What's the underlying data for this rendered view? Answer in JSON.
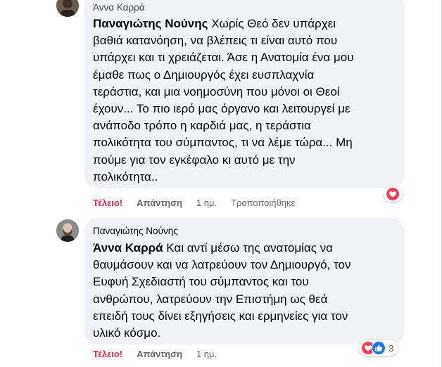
{
  "colors": {
    "bubble_bg": "#f0f2f5",
    "reaction_red": "#f02849",
    "love_red": "#f33e58",
    "like_blue": "#1877f2",
    "meta_gray": "#65676b"
  },
  "comments": [
    {
      "author": "Άννα Καρρά",
      "mention": "Παναγιώτης Νούνης",
      "lines": [
        "Χωρίς Θεό δεν υπάρχει",
        "βαθιά κατανόηση, να βλέπεις τι είναι αυτό που",
        "υπάρχει και τι χρειάζεται. Άσε η Ανατομία ένα μου",
        "έμαθε πως ο Δημιουργός έχει ευσπλαχνία",
        "τεράστια, και μια νοημοσύνη που μόνοι οι Θεοί",
        "έχουν... Το πιο ιερό μας όργανο και λειτουργεί με",
        "ανάποδο τρόπο η καρδιά μας, η τεράστια",
        "πολικότητα του σύμπαντος, τι να λέμε τώρα... Μη",
        "πούμε για τον εγκέφαλο κι αυτό με την",
        "πολικότητα.."
      ],
      "actions": {
        "reaction": "Τέλειο!",
        "reply": "Απάντηση",
        "time": "1 ημ.",
        "edited": "Τροποποιήθηκε"
      },
      "reactions": {
        "icons": [
          "love-icon"
        ],
        "count": ""
      }
    },
    {
      "author": "Παναγιώτης Νούνης",
      "mention": "Άννα Καρρά",
      "lines": [
        "Και αντί μέσω της ανατομίας να",
        "θαυμάσουν και να λατρεύουν τον Δημιουργό, τον",
        "Ευφυή Σχεδιαστή του σύμπαντος και του",
        "ανθρώπου, λατρεύουν την Επιστήμη ως θεά",
        "επειδή τους δίνει εξηγήσεις και ερμηνείες για τον",
        "υλικό κόσμο."
      ],
      "actions": {
        "reaction": "Τέλειο!",
        "reply": "Απάντηση",
        "time": "1 ημ."
      },
      "reactions": {
        "icons": [
          "love-icon",
          "like-icon"
        ],
        "count": "3"
      }
    }
  ]
}
